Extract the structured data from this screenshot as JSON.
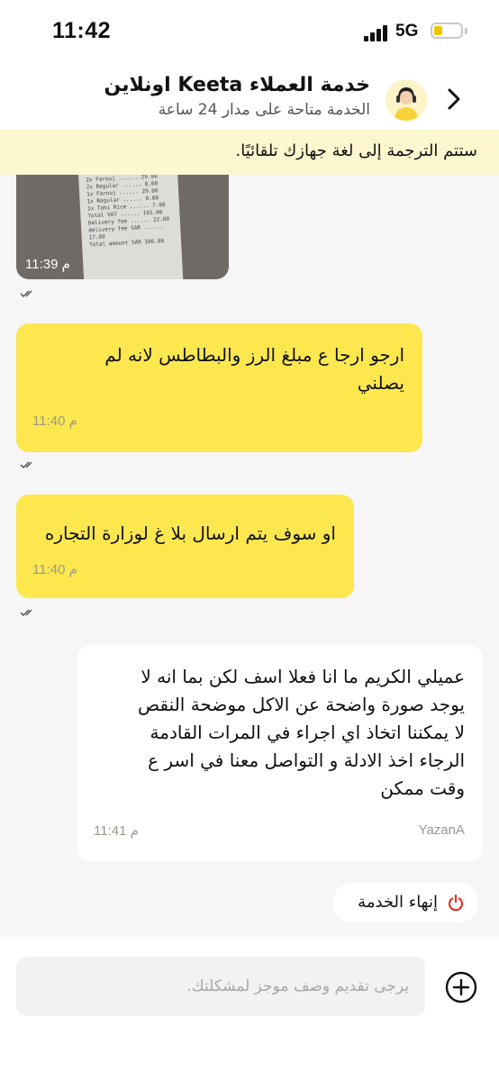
{
  "status_bar": {
    "time": "11:42",
    "network": "5G"
  },
  "header": {
    "title": "خدمة العملاء Keeta اونلاين",
    "subtitle": "الخدمة متاحة على مدار 24 ساعة"
  },
  "translation_banner": "ستتم الترجمة إلى لغة جهازك تلقائيًا.",
  "messages": [
    {
      "type": "image",
      "from": "user",
      "time": "11:39 م"
    },
    {
      "type": "text",
      "from": "user",
      "lines": [
        "ارجو ارجا ع مبلغ الرز والبطاطس لانه لم",
        "يصلني"
      ],
      "time": "11:40 م"
    },
    {
      "type": "text",
      "from": "user",
      "lines": [
        "او سوف يتم ارسال بلا غ لوزارة التجاره"
      ],
      "time": "11:40 م"
    },
    {
      "type": "text",
      "from": "agent",
      "lines": [
        "عميلي الكريم ما انا فعلا اسف لكن بما انه لا",
        "يوجد صورة واضحة عن الاكل موضحة النقص",
        "لا يمكننا اتخاذ اي اجراء في المرات القادمة",
        "الرجاء اخذ الادلة و التواصل معنا في اسر ع",
        "وقت ممكن"
      ],
      "time": "11:41 م",
      "sender": "YazanA"
    }
  ],
  "end_service_label": "إنهاء الخدمة",
  "input": {
    "placeholder": "يرجى تقديم وصف موجز لمشكلتك.",
    "value": ""
  },
  "colors": {
    "accent": "#fde74f",
    "banner": "#fdf7cf",
    "end_icon": "#e0352b"
  }
}
